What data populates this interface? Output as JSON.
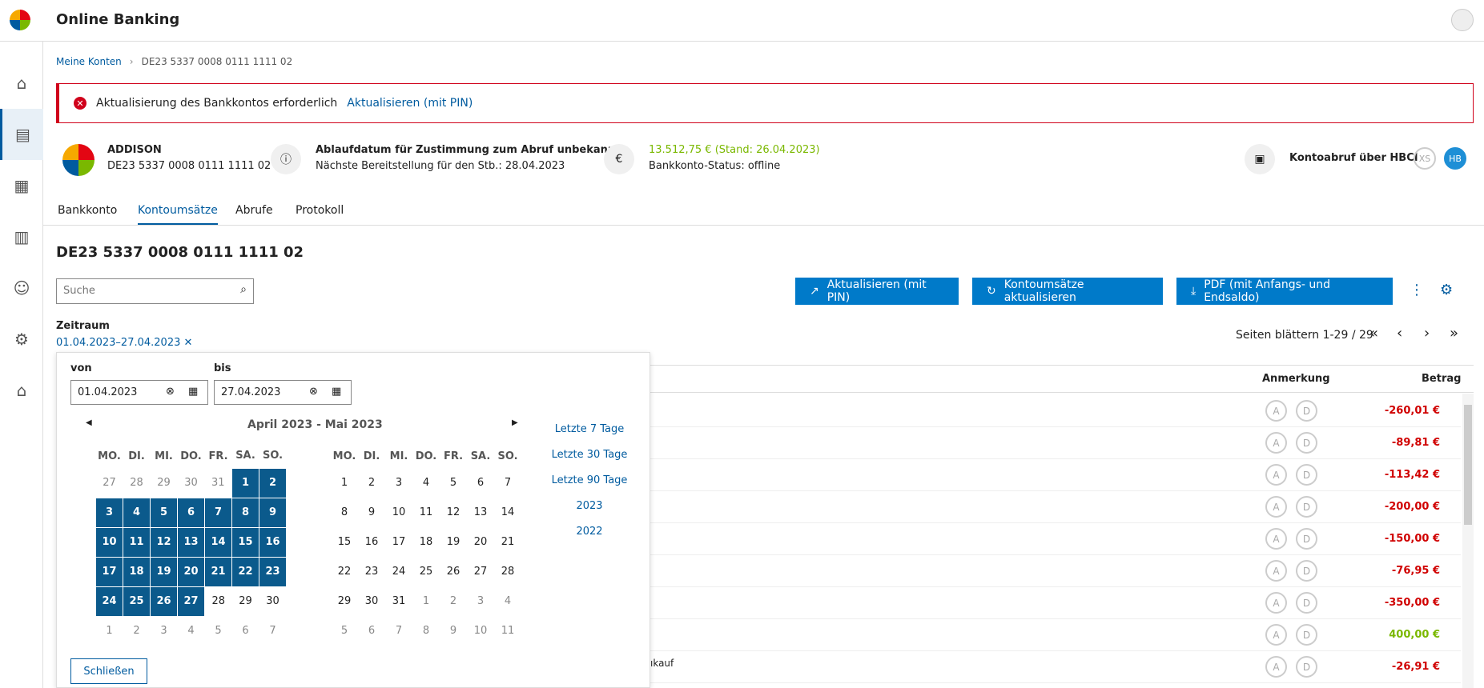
{
  "app": {
    "title": "Online Banking"
  },
  "breadcrumb": {
    "root": "Meine Konten",
    "sep": "›",
    "current": "DE23 5337 0008 0111 1111 02"
  },
  "alert": {
    "message": "Aktualisierung des Bankkontos erforderlich",
    "action": "Aktualisieren (mit PIN)"
  },
  "account": {
    "name": "ADDISON",
    "iban": "DE23 5337 0008 0111 1111 02",
    "consent_title": "Ablaufdatum für Zustimmung zum Abruf unbekannt",
    "consent_sub": "Nächste Bereitstellung für den Stb.: 28.04.2023",
    "balance": "13.512,75 € (Stand: 26.04.2023)",
    "status": "Bankkonto-Status: offline",
    "hbci": "Kontoabruf über HBCI",
    "badge1": "XS",
    "badge2": "HB"
  },
  "tabs": [
    "Bankkonto",
    "Kontoumsätze",
    "Abrufe",
    "Protokoll"
  ],
  "page_title": "DE23 5337 0008 0111 1111 02",
  "search": {
    "placeholder": "Suche"
  },
  "buttons": {
    "update_pin": "Aktualisieren (mit PIN)",
    "refresh": "Kontoumsätze aktualisieren",
    "pdf": "PDF (mit Anfangs- und Endsaldo)"
  },
  "period": {
    "label": "Zeitraum",
    "value": "01.04.2023–27.04.2023"
  },
  "pager": {
    "text": "Seiten blättern 1-29 / 29"
  },
  "table": {
    "col_note": "Anmerkung",
    "col_amount": "Betrag",
    "a": "A",
    "d": "D",
    "amounts": [
      "-260,01 €",
      "-89,81 €",
      "-113,42 €",
      "-200,00 €",
      "-150,00 €",
      "-76,95 €",
      "-350,00 €",
      "400,00 €",
      "-26,91 €"
    ],
    "partial_text": "ıkauf"
  },
  "datepicker": {
    "from_label": "von",
    "to_label": "bis",
    "from": "01.04.2023",
    "to": "27.04.2023",
    "range_title": "April 2023 - Mai 2023",
    "weekdays": [
      "MO.",
      "DI.",
      "MI.",
      "DO.",
      "FR.",
      "SA.",
      "SO."
    ],
    "april": [
      [
        "27",
        "28",
        "29",
        "30",
        "31",
        "1",
        "2"
      ],
      [
        "3",
        "4",
        "5",
        "6",
        "7",
        "8",
        "9"
      ],
      [
        "10",
        "11",
        "12",
        "13",
        "14",
        "15",
        "16"
      ],
      [
        "17",
        "18",
        "19",
        "20",
        "21",
        "22",
        "23"
      ],
      [
        "24",
        "25",
        "26",
        "27",
        "28",
        "29",
        "30"
      ],
      [
        "1",
        "2",
        "3",
        "4",
        "5",
        "6",
        "7"
      ]
    ],
    "may": [
      [
        "1",
        "2",
        "3",
        "4",
        "5",
        "6",
        "7"
      ],
      [
        "8",
        "9",
        "10",
        "11",
        "12",
        "13",
        "14"
      ],
      [
        "15",
        "16",
        "17",
        "18",
        "19",
        "20",
        "21"
      ],
      [
        "22",
        "23",
        "24",
        "25",
        "26",
        "27",
        "28"
      ],
      [
        "29",
        "30",
        "31",
        "1",
        "2",
        "3",
        "4"
      ],
      [
        "5",
        "6",
        "7",
        "8",
        "9",
        "10",
        "11"
      ]
    ],
    "quick": [
      "Letzte 7 Tage",
      "Letzte 30 Tage",
      "Letzte 90 Tage",
      "2023",
      "2022"
    ],
    "close": "Schließen"
  },
  "colors": {
    "accent": "#005b9f",
    "negative": "#d00000",
    "positive": "#7ab800",
    "alert": "#d0021b"
  }
}
